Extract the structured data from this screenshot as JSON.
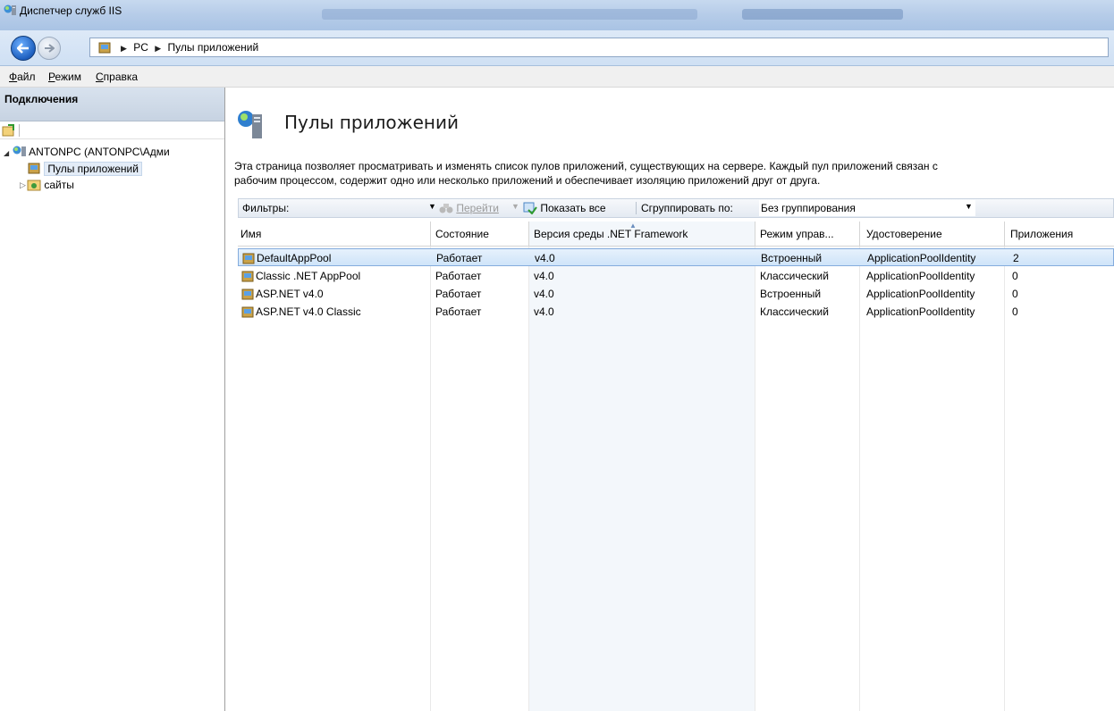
{
  "window": {
    "title": "Диспетчер служб IIS"
  },
  "address": {
    "crumbs": [
      "PC",
      "Пулы приложений"
    ]
  },
  "menu": [
    "Файл",
    "Режим",
    "Справка"
  ],
  "connections": {
    "header": "Подключения",
    "tree": {
      "server": "ANTONPC (ANTONPC\\Адми",
      "app_pools": "Пулы приложений",
      "sites": "сайты"
    }
  },
  "page": {
    "title": "Пулы приложений",
    "description_line1": "Эта страница позволяет просматривать и изменять список пулов приложений, существующих на сервере. Каждый пул приложений связан с",
    "description_line2": "рабочим процессом, содержит одно или несколько приложений и обеспечивает изоляцию приложений друг от друга."
  },
  "filterbar": {
    "filter_label": "Фильтры:",
    "go_label": "Перейти",
    "show_all_label": "Показать все",
    "group_by_label": "Сгруппировать по:",
    "group_by_value": "Без группирования"
  },
  "table": {
    "columns": [
      "Имя",
      "Состояние",
      "Версия среды .NET Framework",
      "Режим управ...",
      "Удостоверение",
      "Приложения"
    ],
    "rows": [
      {
        "name": "DefaultAppPool",
        "state": "Работает",
        "version": "v4.0",
        "mode": "Встроенный",
        "identity": "ApplicationPoolIdentity",
        "apps": "2"
      },
      {
        "name": "Classic .NET AppPool",
        "state": "Работает",
        "version": "v4.0",
        "mode": "Классический",
        "identity": "ApplicationPoolIdentity",
        "apps": "0"
      },
      {
        "name": "ASP.NET v4.0",
        "state": "Работает",
        "version": "v4.0",
        "mode": "Встроенный",
        "identity": "ApplicationPoolIdentity",
        "apps": "0"
      },
      {
        "name": "ASP.NET v4.0 Classic",
        "state": "Работает",
        "version": "v4.0",
        "mode": "Классический",
        "identity": "ApplicationPoolIdentity",
        "apps": "0"
      }
    ]
  }
}
